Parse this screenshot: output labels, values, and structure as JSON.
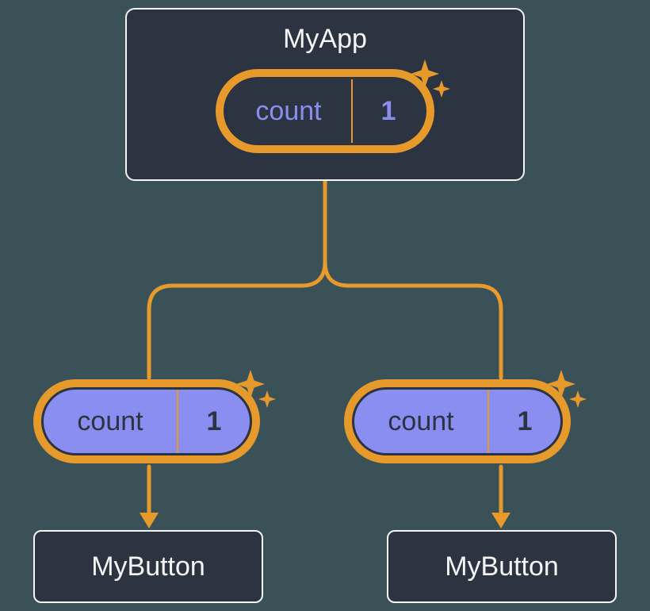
{
  "parent": {
    "title": "MyApp",
    "state": {
      "label": "count",
      "value": "1"
    }
  },
  "children": [
    {
      "state": {
        "label": "count",
        "value": "1"
      },
      "title": "MyButton"
    },
    {
      "state": {
        "label": "count",
        "value": "1"
      },
      "title": "MyButton"
    }
  ],
  "colors": {
    "background": "#3a5157",
    "box": "#2c3341",
    "outline": "#f5f5f5",
    "accent": "#E69A2B",
    "state_text": "#8a8ef0",
    "state_fill": "#8a8ef0"
  }
}
